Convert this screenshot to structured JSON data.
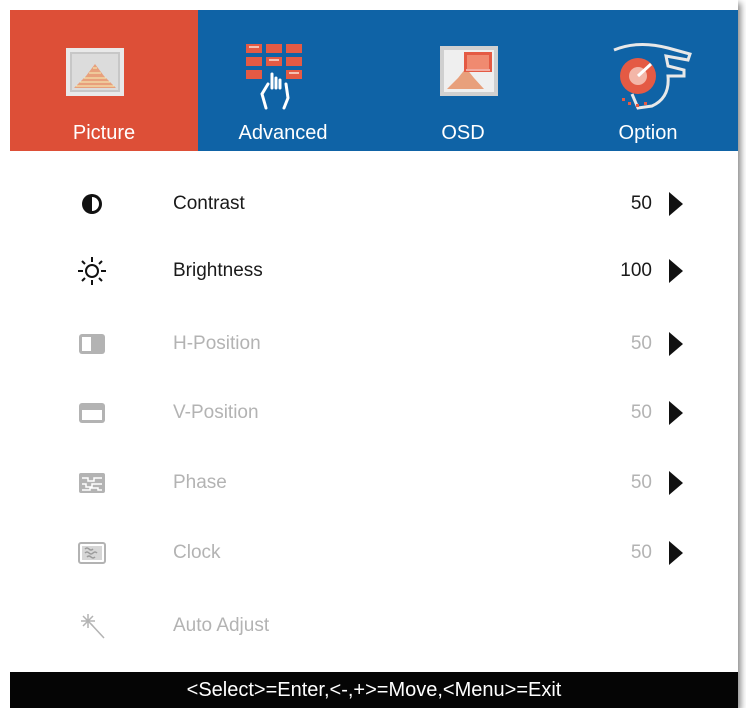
{
  "colors": {
    "tab_bar": "#0f63a6",
    "active_tab": "#dd4f37",
    "footer": "#050505",
    "text": "#1a1a1a",
    "disabled_text": "#b3b3b3"
  },
  "tabs": [
    {
      "label": "Picture",
      "icon": "picture-icon",
      "active": true
    },
    {
      "label": "Advanced",
      "icon": "advanced-icon",
      "active": false
    },
    {
      "label": "OSD",
      "icon": "osd-icon",
      "active": false
    },
    {
      "label": "Option",
      "icon": "option-icon",
      "active": false
    }
  ],
  "items": [
    {
      "label": "Contrast",
      "value": "50",
      "icon": "contrast-icon",
      "enabled": true
    },
    {
      "label": "Brightness",
      "value": "100",
      "icon": "brightness-icon",
      "enabled": true
    },
    {
      "label": "H-Position",
      "value": "50",
      "icon": "h-position-icon",
      "enabled": false
    },
    {
      "label": "V-Position",
      "value": "50",
      "icon": "v-position-icon",
      "enabled": false
    },
    {
      "label": "Phase",
      "value": "50",
      "icon": "phase-icon",
      "enabled": false
    },
    {
      "label": "Clock",
      "value": "50",
      "icon": "clock-icon",
      "enabled": false
    },
    {
      "label": "Auto Adjust",
      "icon": "auto-adjust-icon",
      "enabled": false
    }
  ],
  "footer": {
    "hint": "<Select>=Enter,<-,+>=Move,<Menu>=Exit"
  }
}
